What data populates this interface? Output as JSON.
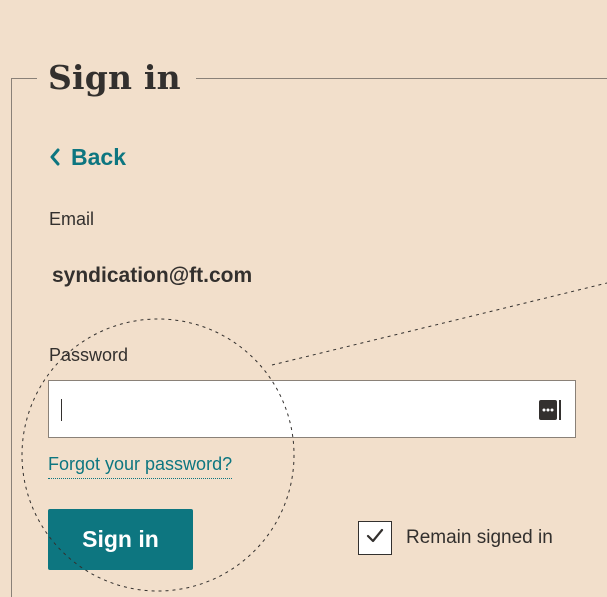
{
  "form": {
    "legend": "Sign in",
    "back_label": "Back",
    "email_label": "Email",
    "email_value": "syndication@ft.com",
    "password_label": "Password",
    "password_value": "",
    "forgot_label": "Forgot your password?",
    "submit_label": "Sign in",
    "remember_label": "Remain signed in",
    "remember_checked": true
  },
  "icons": {
    "back": "chevron-left-icon",
    "keychain": "password-autofill-icon",
    "check": "checkmark-icon"
  },
  "colors": {
    "background": "#f2dfcb",
    "accent": "#0d7680",
    "text": "#33302e"
  }
}
